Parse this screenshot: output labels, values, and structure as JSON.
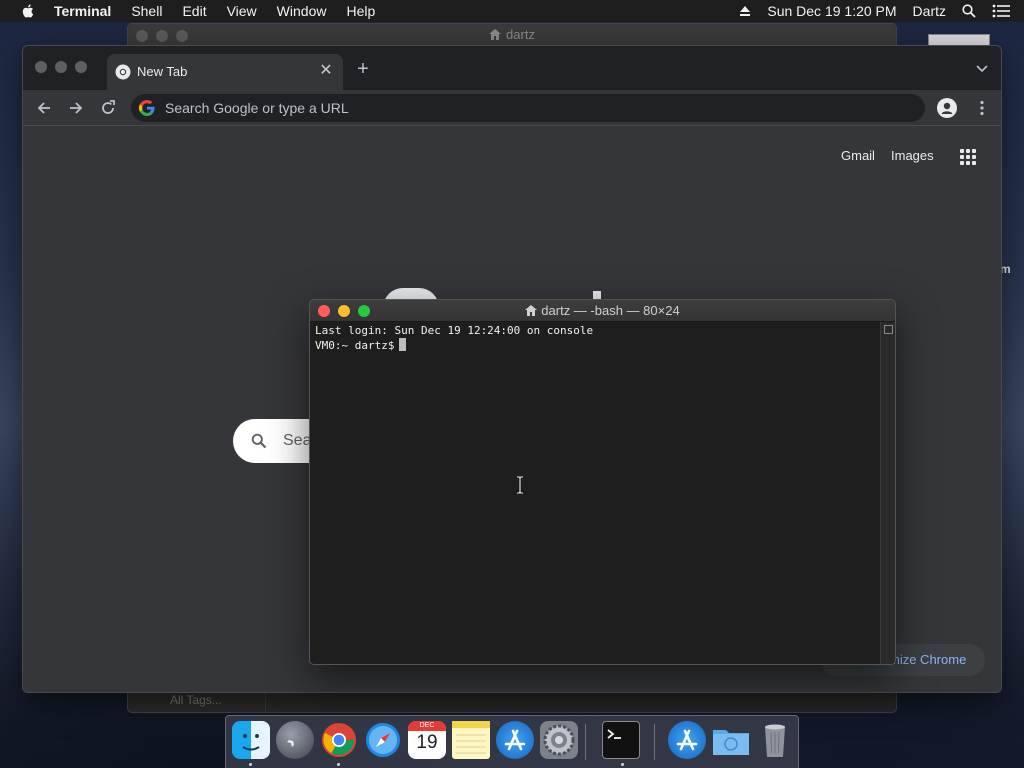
{
  "menubar": {
    "app": "Terminal",
    "items": [
      "Shell",
      "Edit",
      "View",
      "Window",
      "Help"
    ],
    "clock": "Sun Dec 19  1:20 PM",
    "user": "Dartz"
  },
  "background_window": {
    "title": "dartz",
    "footer": "All Tags..."
  },
  "desktop": {
    "label_fragment": "m"
  },
  "chrome": {
    "tab_title": "New Tab",
    "omnibox_placeholder": "Search Google or type a URL",
    "ntp": {
      "gmail": "Gmail",
      "images": "Images",
      "search_text": "Sea",
      "customize": "mize Chrome"
    }
  },
  "terminal": {
    "title": "dartz — -bash — 80×24",
    "lines": [
      "Last login: Sun Dec 19 12:24:00 on console",
      "VM0:~ dartz$"
    ]
  },
  "dock": {
    "calendar_month": "DEC",
    "calendar_day": "19",
    "items": [
      "Finder",
      "Launchpad",
      "Google Chrome",
      "Safari",
      "Calendar",
      "Notes",
      "App Store",
      "System Preferences",
      "Terminal",
      "Applications",
      "Downloads",
      "Trash"
    ]
  },
  "colors": {
    "chrome_bg": "#35363a",
    "chrome_tabstrip": "#202124",
    "terminal_bg": "#1e1e1e",
    "close": "#ff5f57",
    "minimize": "#febc2e",
    "zoom": "#28c840",
    "link_blue": "#8ab4f8"
  }
}
